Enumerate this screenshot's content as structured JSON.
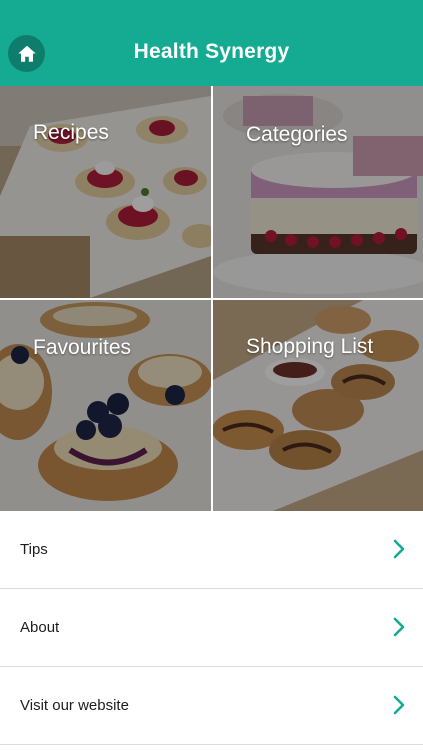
{
  "header": {
    "title": "Health Synergy",
    "home_icon": "home-icon",
    "color": "#15ab92"
  },
  "tiles": [
    {
      "label": "Recipes"
    },
    {
      "label": "Categories"
    },
    {
      "label": "Favourites"
    },
    {
      "label": "Shopping List"
    }
  ],
  "menu": [
    {
      "label": "Tips",
      "icon": "chevron-right-icon"
    },
    {
      "label": "About",
      "icon": "chevron-right-icon"
    },
    {
      "label": "Visit our website",
      "icon": "chevron-right-icon"
    }
  ],
  "accent": "#15ab92"
}
